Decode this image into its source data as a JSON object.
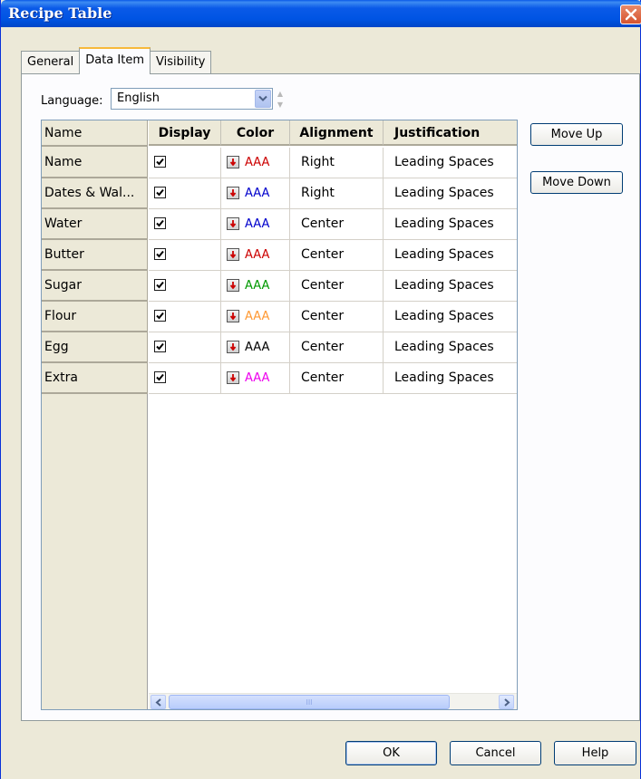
{
  "window": {
    "title": "Recipe Table"
  },
  "tabs": [
    {
      "label": "General",
      "active": false
    },
    {
      "label": "Data Item",
      "active": true
    },
    {
      "label": "Visibility",
      "active": false
    }
  ],
  "language": {
    "label": "Language:",
    "value": "English"
  },
  "grid": {
    "corner_header": "Name",
    "columns": [
      "Display",
      "Color",
      "Alignment",
      "Justification"
    ],
    "rows": [
      {
        "name": "Name",
        "display": true,
        "color_text": "AAA",
        "color": "#cc0000",
        "alignment": "Right",
        "justification": "Leading Spaces"
      },
      {
        "name": "Dates & Wal...",
        "display": true,
        "color_text": "AAA",
        "color": "#0000cc",
        "alignment": "Right",
        "justification": "Leading Spaces"
      },
      {
        "name": "Water",
        "display": true,
        "color_text": "AAA",
        "color": "#0000cc",
        "alignment": "Center",
        "justification": "Leading Spaces"
      },
      {
        "name": "Butter",
        "display": true,
        "color_text": "AAA",
        "color": "#cc0000",
        "alignment": "Center",
        "justification": "Leading Spaces"
      },
      {
        "name": "Sugar",
        "display": true,
        "color_text": "AAA",
        "color": "#009900",
        "alignment": "Center",
        "justification": "Leading Spaces"
      },
      {
        "name": "Flour",
        "display": true,
        "color_text": "AAA",
        "color": "#ff9933",
        "alignment": "Center",
        "justification": "Leading Spaces"
      },
      {
        "name": "Egg",
        "display": true,
        "color_text": "AAA",
        "color": "#000000",
        "alignment": "Center",
        "justification": "Leading Spaces"
      },
      {
        "name": "Extra",
        "display": true,
        "color_text": "AAA",
        "color": "#ee00ee",
        "alignment": "Center",
        "justification": "Leading Spaces"
      }
    ],
    "scrollbar_grip": "III"
  },
  "buttons": {
    "move_up": "Move Up",
    "move_down": "Move Down",
    "ok": "OK",
    "cancel": "Cancel",
    "help": "Help"
  }
}
